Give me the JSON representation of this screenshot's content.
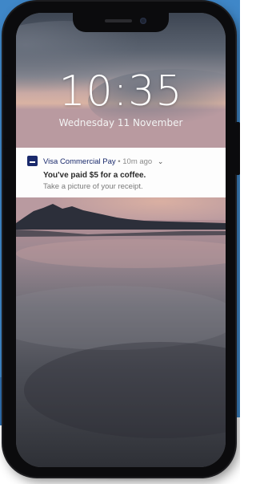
{
  "lock_screen": {
    "time": "10:35",
    "date": "Wednesday 11 November"
  },
  "notification": {
    "app_name": "Visa Commercial Pay",
    "separator": "•",
    "time_ago": "10m ago",
    "title": "You've paid $5 for a coffee.",
    "body": "Take a picture of your receipt."
  },
  "icons": {
    "app_icon": "visa-card-icon",
    "expand_icon": "chevron-down-icon"
  },
  "colors": {
    "backdrop": "#3f87c8",
    "phone_body": "#0b0b0d",
    "notification_bg": "#fdfdfd",
    "app_accent": "#1a2a6c"
  }
}
